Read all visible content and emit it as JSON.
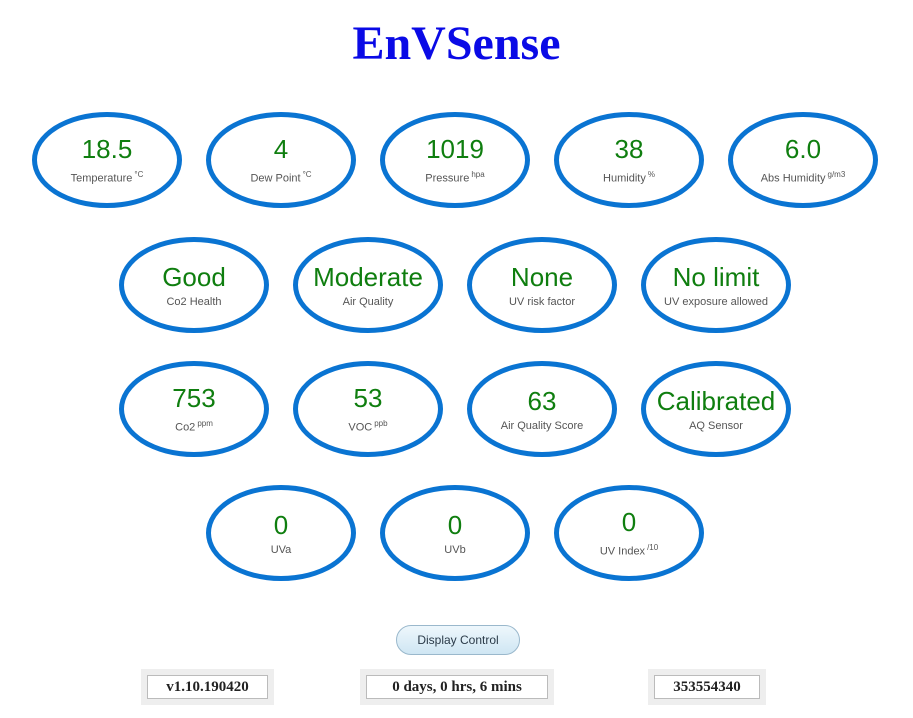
{
  "header": {
    "title": "EnVSense"
  },
  "gauges": {
    "temperature": {
      "value": "18.5",
      "label": "Temperature",
      "unit": "°C"
    },
    "dew_point": {
      "value": "4",
      "label": "Dew Point",
      "unit": "°C"
    },
    "pressure": {
      "value": "1019",
      "label": "Pressure",
      "unit": "hpa"
    },
    "humidity": {
      "value": "38",
      "label": "Humidity",
      "unit": "%"
    },
    "abs_humidity": {
      "value": "6.0",
      "label": "Abs Humidity",
      "unit": "g/m3"
    },
    "co2_health": {
      "value": "Good",
      "label": "Co2 Health"
    },
    "air_quality": {
      "value": "Moderate",
      "label": "Air Quality"
    },
    "uv_risk": {
      "value": "None",
      "label": "UV risk factor"
    },
    "uv_exposure": {
      "value": "No limit",
      "label": "UV exposure allowed"
    },
    "co2": {
      "value": "753",
      "label": "Co2",
      "unit": "ppm"
    },
    "voc": {
      "value": "53",
      "label": "VOC",
      "unit": "ppb"
    },
    "aq_score": {
      "value": "63",
      "label": "Air Quality Score"
    },
    "aq_sensor": {
      "value": "Calibrated",
      "label": "AQ Sensor"
    },
    "uva": {
      "value": "0",
      "label": "UVa"
    },
    "uvb": {
      "value": "0",
      "label": "UVb"
    },
    "uv_index": {
      "value": "0",
      "label": "UV Index",
      "unit": "/10"
    }
  },
  "controls": {
    "display_control_label": "Display Control"
  },
  "footer": {
    "version": "v1.10.190420",
    "uptime": "0 days, 0 hrs, 6 mins",
    "counter": "353554340"
  },
  "colors": {
    "title": "#0a0ae6",
    "gauge_border": "#0a74d2",
    "gauge_value": "#0f7e0f",
    "gauge_label": "#555555"
  }
}
